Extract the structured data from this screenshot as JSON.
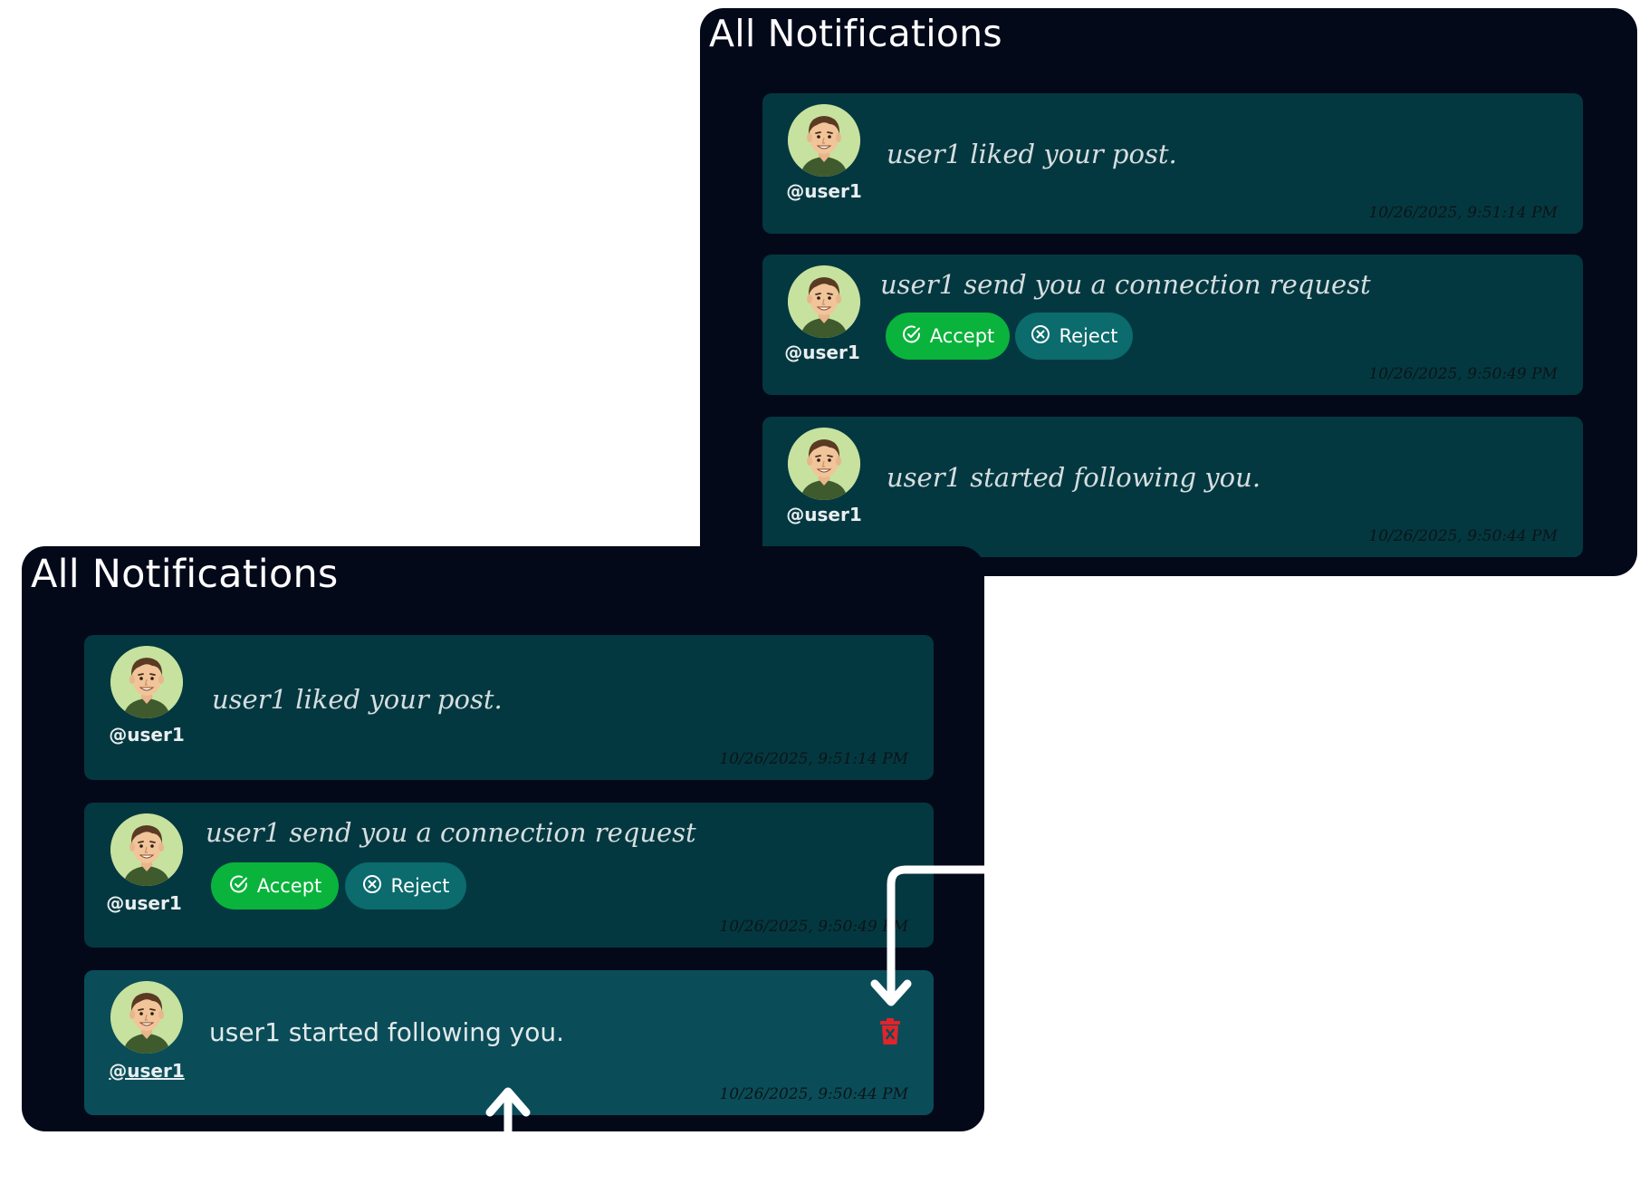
{
  "panels": [
    {
      "title": "All Notifications",
      "notifications": [
        {
          "handle": "@user1",
          "message": "user1 liked your post.",
          "time": "10/26/2025, 9:51:14 PM"
        },
        {
          "handle": "@user1",
          "message": "user1 send you a connection request",
          "time": "10/26/2025, 9:50:49 PM",
          "accept_label": "Accept",
          "reject_label": "Reject"
        },
        {
          "handle": "@user1",
          "message": "user1 started following you.",
          "time": "10/26/2025, 9:50:44 PM"
        }
      ]
    },
    {
      "title": "All Notifications",
      "notifications": [
        {
          "handle": "@user1",
          "message": "user1 liked your post.",
          "time": "10/26/2025, 9:51:14 PM"
        },
        {
          "handle": "@user1",
          "message": "user1 send you a connection request",
          "time": "10/26/2025, 9:50:49 PM",
          "accept_label": "Accept",
          "reject_label": "Reject"
        },
        {
          "handle": "@user1",
          "message": "user1 started following you.",
          "time": "10/26/2025, 9:50:44 PM",
          "state": "hovered"
        }
      ]
    }
  ],
  "colors": {
    "page_background": "#ffffff",
    "panel_background": "#04091a",
    "card_background": "#043840",
    "card_hover_background": "#0a4d58",
    "accept_button": "#0ab33c",
    "reject_button": "#0b6b6d",
    "delete_icon": "#e0242c",
    "annotation_arrow": "#ffffff"
  },
  "icons": {
    "avatar": "avatar-cartoon-man",
    "accept": "check-circle-icon",
    "reject": "x-circle-icon",
    "delete": "trash-icon",
    "annotation": "arrow-icon"
  }
}
